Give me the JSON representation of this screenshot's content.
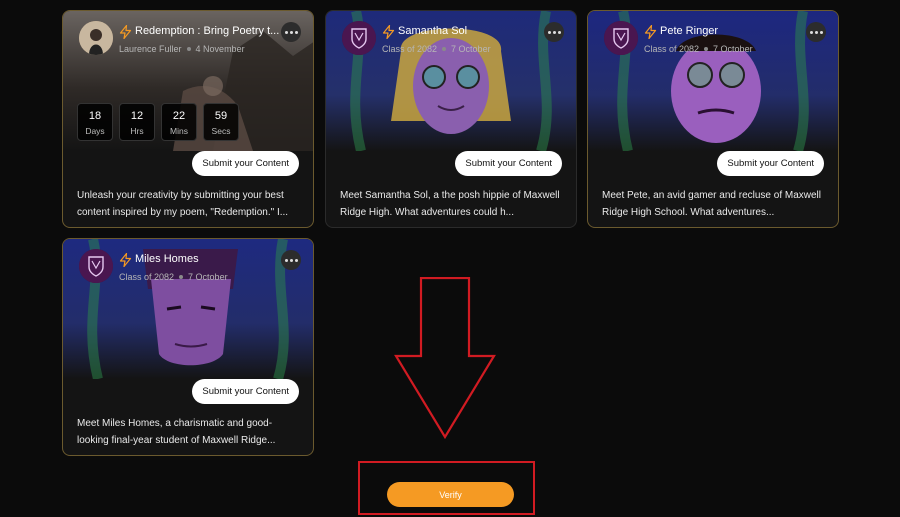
{
  "cards": [
    {
      "title": "Redemption : Bring Poetry t...",
      "author": "Laurence Fuller",
      "date": "4 November",
      "countdown": [
        {
          "value": "18",
          "unit": "Days"
        },
        {
          "value": "12",
          "unit": "Hrs"
        },
        {
          "value": "22",
          "unit": "Mins"
        },
        {
          "value": "59",
          "unit": "Secs"
        }
      ],
      "button": "Submit your Content",
      "description": "Unleash your creativity by submitting your best content inspired by my poem, \"Redemption.\" I..."
    },
    {
      "title": "Samantha Sol",
      "author": "Class of 2082",
      "date": "7 October",
      "button": "Submit your Content",
      "description": "Meet Samantha Sol, a the posh hippie of Maxwell Ridge High. What adventures could h..."
    },
    {
      "title": "Pete Ringer",
      "author": "Class of 2082",
      "date": "7 October",
      "button": "Submit your Content",
      "description": "Meet Pete, an avid gamer and recluse of Maxwell Ridge High School. What adventures..."
    },
    {
      "title": "Miles Homes",
      "author": "Class of 2082",
      "date": "7 October",
      "button": "Submit your Content",
      "description": "Meet Miles Homes, a charismatic and good-looking final-year student of Maxwell Ridge..."
    }
  ],
  "verify": {
    "label": "Verify"
  },
  "colors": {
    "accent": "#f59a23",
    "highlight": "#d11b22",
    "background": "#0b0b0b"
  },
  "icons": [
    "lightning-bolt-icon",
    "more-options-icon",
    "down-arrow-annotation"
  ]
}
